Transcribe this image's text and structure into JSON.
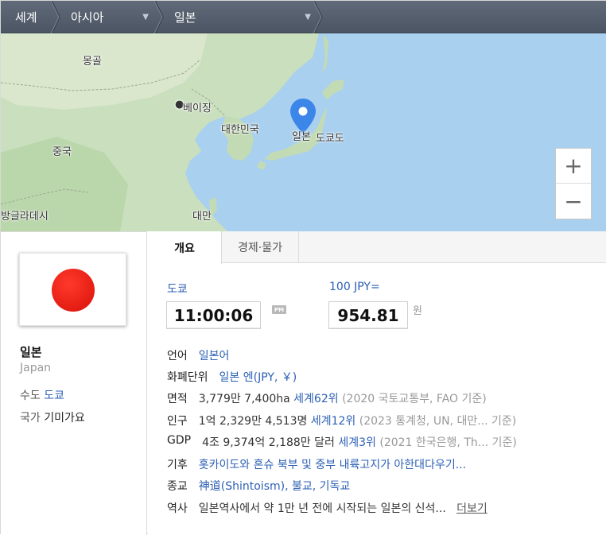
{
  "breadcrumb": {
    "items": [
      "세계",
      "아시아",
      "일본"
    ]
  },
  "map": {
    "labels": {
      "mongolia": "몽골",
      "beijing": "베이징",
      "korea": "대한민국",
      "china": "중국",
      "japan": "일본",
      "tokyo": "도쿄도",
      "bangladesh": "방글라데시",
      "taiwan": "대만"
    },
    "zoom_in": "+",
    "zoom_out": "−"
  },
  "country": {
    "name_ko": "일본",
    "name_en": "Japan",
    "capital_key": "수도",
    "capital_value": "도쿄",
    "anthem_key": "국가",
    "anthem_value": "기미가요"
  },
  "tabs": [
    "개요",
    "경제·물가"
  ],
  "time": {
    "city": "도쿄",
    "value": "11:00:06",
    "ampm": "PM"
  },
  "currency": {
    "label": "100 JPY=",
    "value": "954.81",
    "unit": "원"
  },
  "info": {
    "language": {
      "key": "언어",
      "value": "일본어"
    },
    "currency_unit": {
      "key": "화폐단위",
      "value": "일본 엔(JPY, ￥)"
    },
    "area": {
      "key": "면적",
      "value": "3,779만 7,400ha",
      "rank": "세계62위",
      "source": "(2020 국토교통부, FAO 기준)"
    },
    "population": {
      "key": "인구",
      "value": "1억 2,329만 4,513명",
      "rank": "세계12위",
      "source": "(2023 통계청, UN, 대만... 기준)"
    },
    "gdp": {
      "key": "GDP",
      "value": "4조 9,374억 2,188만 달러",
      "rank": "세계3위",
      "source": "(2021 한국은행, Th... 기준)"
    },
    "climate": {
      "key": "기후",
      "value": "홋카이도와 혼슈 북부 및 중부 내륙고지가 아한대다우기..."
    },
    "religion": {
      "key": "종교",
      "value": "神道(Shintoism), 불교, 기독교"
    },
    "history": {
      "key": "역사",
      "value": "일본역사에서 약 1만 년 전에 시작되는 일본의 신석...",
      "more": "더보기"
    }
  }
}
